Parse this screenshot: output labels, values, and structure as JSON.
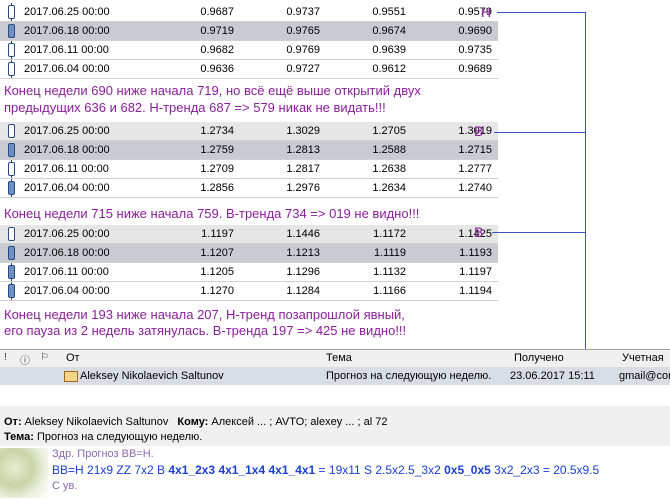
{
  "tables": [
    {
      "rows": [
        {
          "date": "2017.06.25 00:00",
          "o": "0.9687",
          "h": "0.9737",
          "l": "0.9551",
          "c": "0.9579",
          "style": "",
          "bear": false
        },
        {
          "date": "2017.06.18 00:00",
          "o": "0.9719",
          "h": "0.9765",
          "l": "0.9674",
          "c": "0.9690",
          "style": "sel",
          "bear": true
        },
        {
          "date": "2017.06.11 00:00",
          "o": "0.9682",
          "h": "0.9769",
          "l": "0.9639",
          "c": "0.9735",
          "style": "",
          "bear": false
        },
        {
          "date": "2017.06.04 00:00",
          "o": "0.9636",
          "h": "0.9727",
          "l": "0.9612",
          "c": "0.9689",
          "style": "",
          "bear": false
        }
      ]
    },
    {
      "rows": [
        {
          "date": "2017.06.25 00:00",
          "o": "1.2734",
          "h": "1.3029",
          "l": "1.2705",
          "c": "1.3019",
          "style": "alt",
          "bear": false
        },
        {
          "date": "2017.06.18 00:00",
          "o": "1.2759",
          "h": "1.2813",
          "l": "1.2588",
          "c": "1.2715",
          "style": "sel",
          "bear": true
        },
        {
          "date": "2017.06.11 00:00",
          "o": "1.2709",
          "h": "1.2817",
          "l": "1.2638",
          "c": "1.2777",
          "style": "",
          "bear": false
        },
        {
          "date": "2017.06.04 00:00",
          "o": "1.2856",
          "h": "1.2976",
          "l": "1.2634",
          "c": "1.2740",
          "style": "",
          "bear": true
        }
      ]
    },
    {
      "rows": [
        {
          "date": "2017.06.25 00:00",
          "o": "1.1197",
          "h": "1.1446",
          "l": "1.1172",
          "c": "1.1425",
          "style": "alt",
          "bear": false
        },
        {
          "date": "2017.06.18 00:00",
          "o": "1.1207",
          "h": "1.1213",
          "l": "1.1119",
          "c": "1.1193",
          "style": "sel",
          "bear": true
        },
        {
          "date": "2017.06.11 00:00",
          "o": "1.1205",
          "h": "1.1296",
          "l": "1.1132",
          "c": "1.1197",
          "style": "",
          "bear": true
        },
        {
          "date": "2017.06.04 00:00",
          "o": "1.1270",
          "h": "1.1284",
          "l": "1.1166",
          "c": "1.1194",
          "style": "",
          "bear": true
        }
      ]
    }
  ],
  "comments": {
    "c1_line1": "Конец недели 690 ниже начала 719, но всё ещё выше открытий двух",
    "c1_line2": "предыдущих 636 и 682. Н-тренда 687 => 579 никак не видать!!!",
    "c2": "Конец недели 715 ниже начала 759. В-тренда 734 => 019 не видно!!!",
    "c3_line1": "Конец недели 193 ниже начала 207, Н-тренд позапрошлой явный,",
    "c3_line2": "его пауза из 2 недель затянулась. В-тренда 197 => 425 не видно!!!"
  },
  "labels": {
    "h": "Н",
    "b1": "В",
    "b2": "В"
  },
  "mail_list": {
    "col_from": "От",
    "col_subject": "Тема",
    "col_received": "Получено",
    "col_account": "Учетная з",
    "row": {
      "from": "Aleksey Nikolaevich Saltunov",
      "subject": "Прогноз на следующую неделю.",
      "received": "23.06.2017 15:11",
      "account": "gmail@com"
    }
  },
  "preview": {
    "from_label": "От:",
    "from_value": "Aleksey Nikolaevich Saltunov",
    "to_label": "Кому:",
    "to_value": "Алексей ... ; AVTO; alexey ... ; al 72",
    "subject_label": "Тема:",
    "subject_value": "Прогноз на следующую неделю."
  },
  "body": {
    "line1": "Здр.  Прогноз ВВ=Н.",
    "line2a": "ВВ=Н  21х9  ZZ 7х2  В ",
    "line2b": "4х1_2х3 4х1_1х4 4х1_4х1",
    "line2c": " = 19х11  S 2.5х2.5_3х2 ",
    "line2d": "0х5_0х5",
    "line2e": " 3х2_2х3 = 20.5х9.5",
    "line3": "С ув."
  }
}
